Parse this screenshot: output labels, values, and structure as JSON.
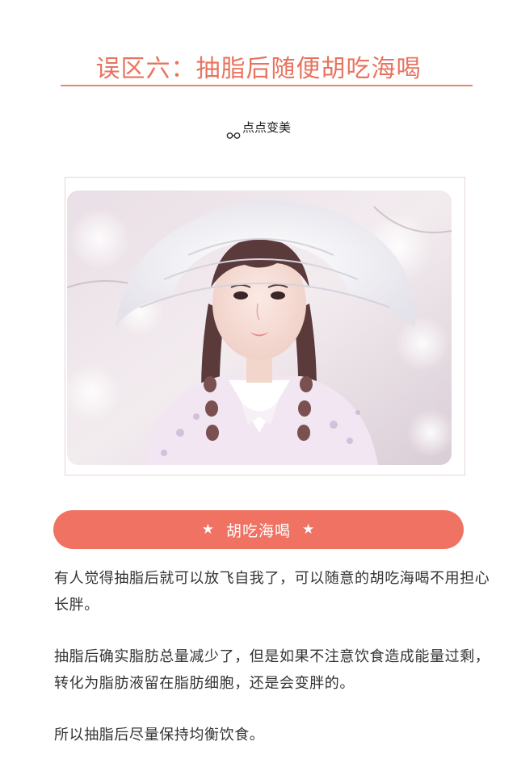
{
  "header": {
    "title": "误区六：抽脂后随便胡吃海喝"
  },
  "author": {
    "icon": "glasses-icon",
    "name": "点点变美"
  },
  "photo": {
    "subject": "girl-in-white-hat-photo"
  },
  "section": {
    "star_left": "★",
    "title": "胡吃海喝",
    "star_right": "★",
    "color": "#ef7263"
  },
  "paragraphs": [
    "有人觉得抽脂后就可以放飞自我了，可以随意的胡吃海喝不用担心长胖。",
    "抽脂后确实脂肪总量减少了，但是如果不注意饮食造成能量过剩，转化为脂肪液留在脂肪细胞，还是会变胖的。",
    "所以抽脂后尽量保持均衡饮食。"
  ],
  "colors": {
    "accent": "#e8735f",
    "text": "#333333"
  }
}
